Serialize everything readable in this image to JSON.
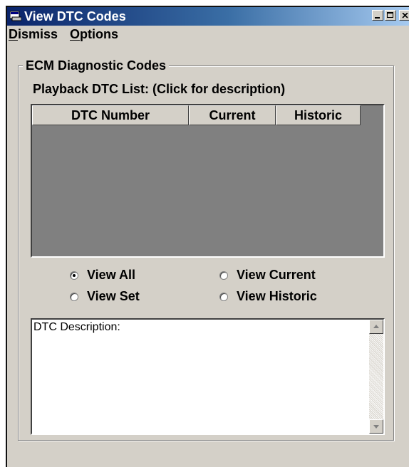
{
  "window": {
    "title": "View DTC Codes",
    "icon": "window-app-icon",
    "caption_buttons": [
      "minimize-icon",
      "maximize-icon",
      "close-icon"
    ]
  },
  "menu": {
    "items": [
      {
        "label": "Dismiss",
        "accel": "D"
      },
      {
        "label": "Options",
        "accel": "O"
      }
    ]
  },
  "group": {
    "legend": "ECM Diagnostic Codes",
    "list_caption": "Playback DTC List: (Click for description)"
  },
  "grid": {
    "columns": [
      "DTC Number",
      "Current",
      "Historic"
    ],
    "rows": []
  },
  "filters": {
    "options": [
      {
        "label": "View All",
        "selected": true
      },
      {
        "label": "View Current",
        "selected": false
      },
      {
        "label": "View Set",
        "selected": false
      },
      {
        "label": "View Historic",
        "selected": false
      }
    ]
  },
  "description": {
    "label": "DTC Description:"
  },
  "colors": {
    "title_gradient_start": "#0a246a",
    "title_gradient_end": "#a6caf0",
    "window_face": "#d4d0c8",
    "grid_background": "#808080"
  }
}
